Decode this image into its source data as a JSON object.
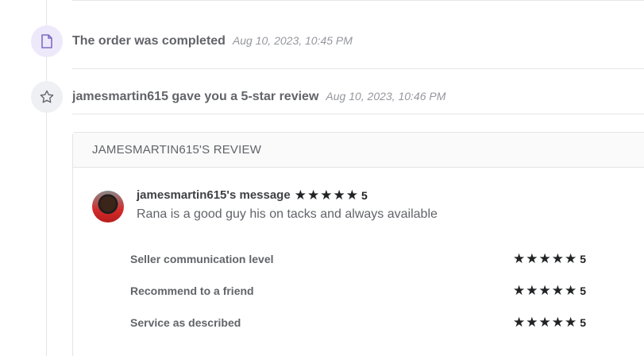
{
  "timeline": {
    "events": [
      {
        "icon": "document-icon",
        "title": "The order was completed",
        "time": "Aug 10, 2023, 10:45 PM"
      },
      {
        "icon": "star-outline-icon",
        "title": "jamesmartin615 gave you a 5-star review",
        "time": "Aug 10, 2023, 10:46 PM"
      }
    ]
  },
  "review": {
    "header": "JAMESMARTIN615'S REVIEW",
    "author_label": "jamesmartin615's message",
    "overall_rating": "5",
    "message": "Rana is a good guy his on tacks and always available",
    "criteria": [
      {
        "label": "Seller communication level",
        "rating": "5"
      },
      {
        "label": "Recommend to a friend",
        "rating": "5"
      },
      {
        "label": "Service as described",
        "rating": "5"
      }
    ]
  },
  "colors": {
    "accent_purple_bg": "#ede9fb",
    "icon_purple": "#7f6cc4",
    "star": "#222325",
    "text_muted": "#95979d"
  }
}
